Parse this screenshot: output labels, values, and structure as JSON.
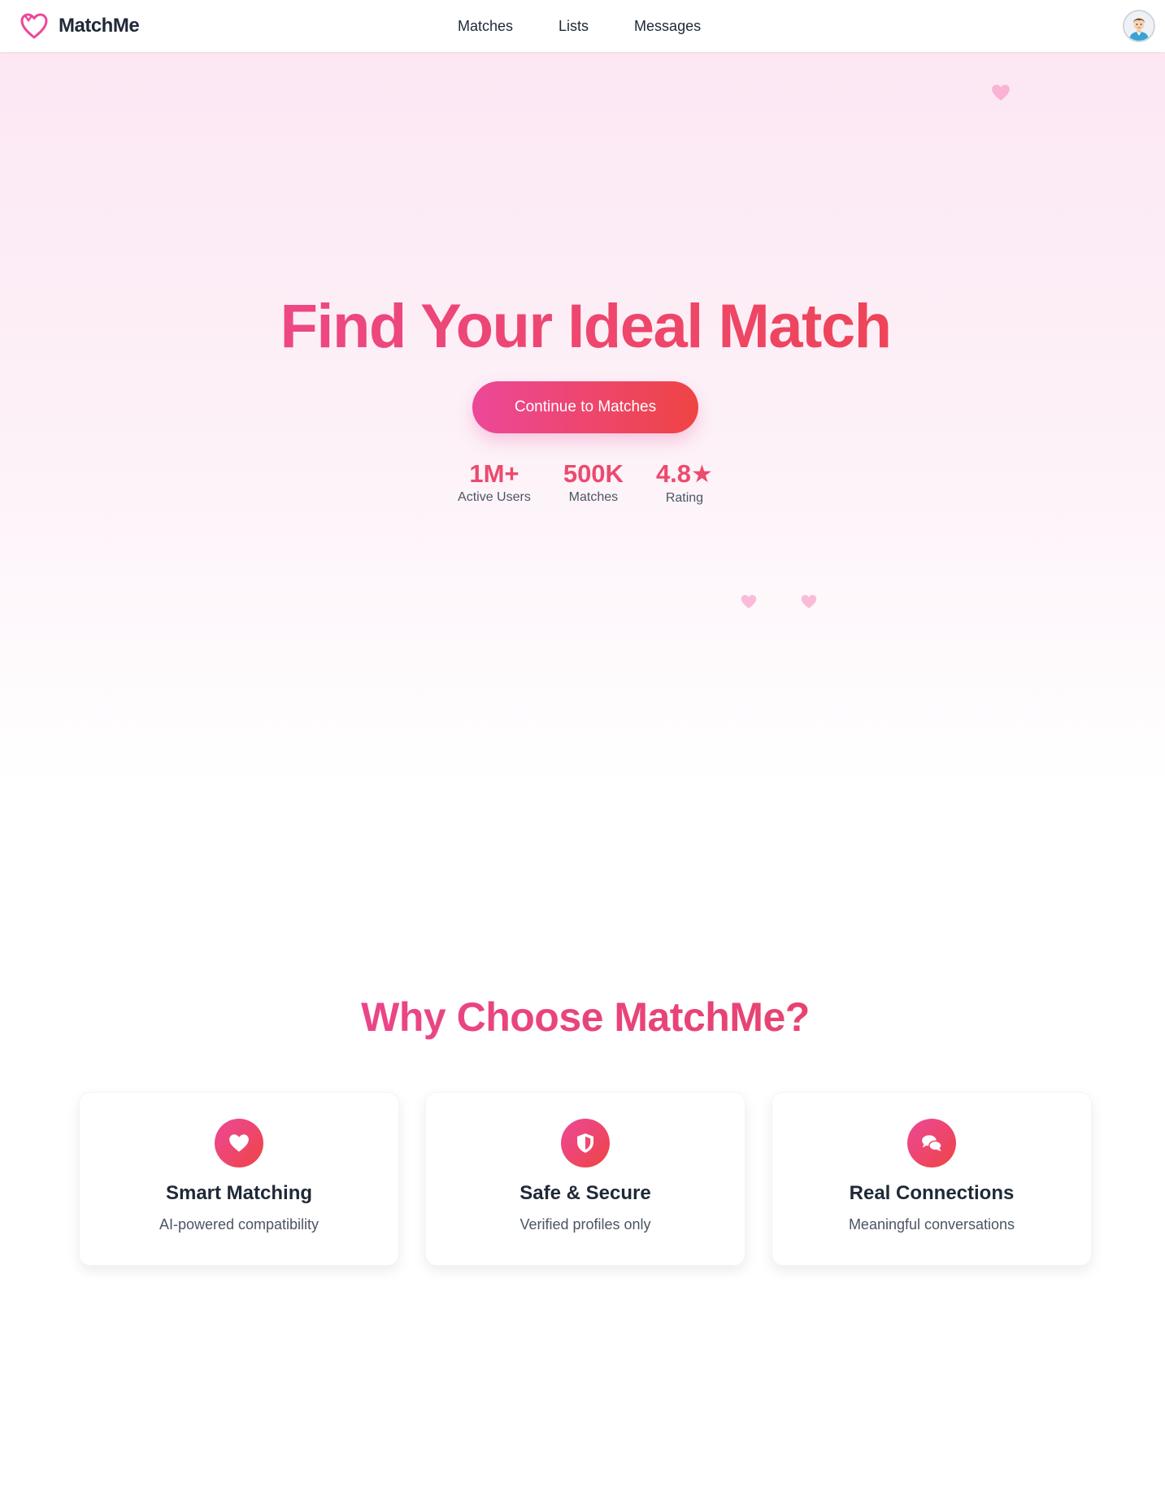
{
  "brand": {
    "name": "MatchMe",
    "logo_icon": "heart-outline-icon",
    "color": "#ec4899"
  },
  "nav": {
    "links": [
      {
        "label": "Matches"
      },
      {
        "label": "Lists"
      },
      {
        "label": "Messages"
      }
    ]
  },
  "user": {
    "avatar_icon": "user-avatar-icon"
  },
  "hero": {
    "title": "Find Your Ideal Match",
    "cta_label": "Continue to Matches",
    "stats": [
      {
        "value": "1M+",
        "label": "Active Users"
      },
      {
        "value": "500K",
        "label": "Matches"
      },
      {
        "value": "4.8",
        "suffix": "★",
        "label": "Rating"
      }
    ],
    "decor_icon": "heart-icon"
  },
  "features": {
    "title": "Why Choose MatchMe?",
    "items": [
      {
        "icon": "heart-icon",
        "title": "Smart Matching",
        "desc": "AI-powered compatibility"
      },
      {
        "icon": "shield-icon",
        "title": "Safe & Secure",
        "desc": "Verified profiles only"
      },
      {
        "icon": "chat-bubbles-icon",
        "title": "Real Connections",
        "desc": "Meaningful conversations"
      }
    ]
  },
  "colors": {
    "accent_pink": "#ec4899",
    "accent_red": "#ef4444",
    "hero_bg_top": "#fce7f3",
    "text_dark": "#1f2937",
    "text_muted": "#4b5563"
  }
}
